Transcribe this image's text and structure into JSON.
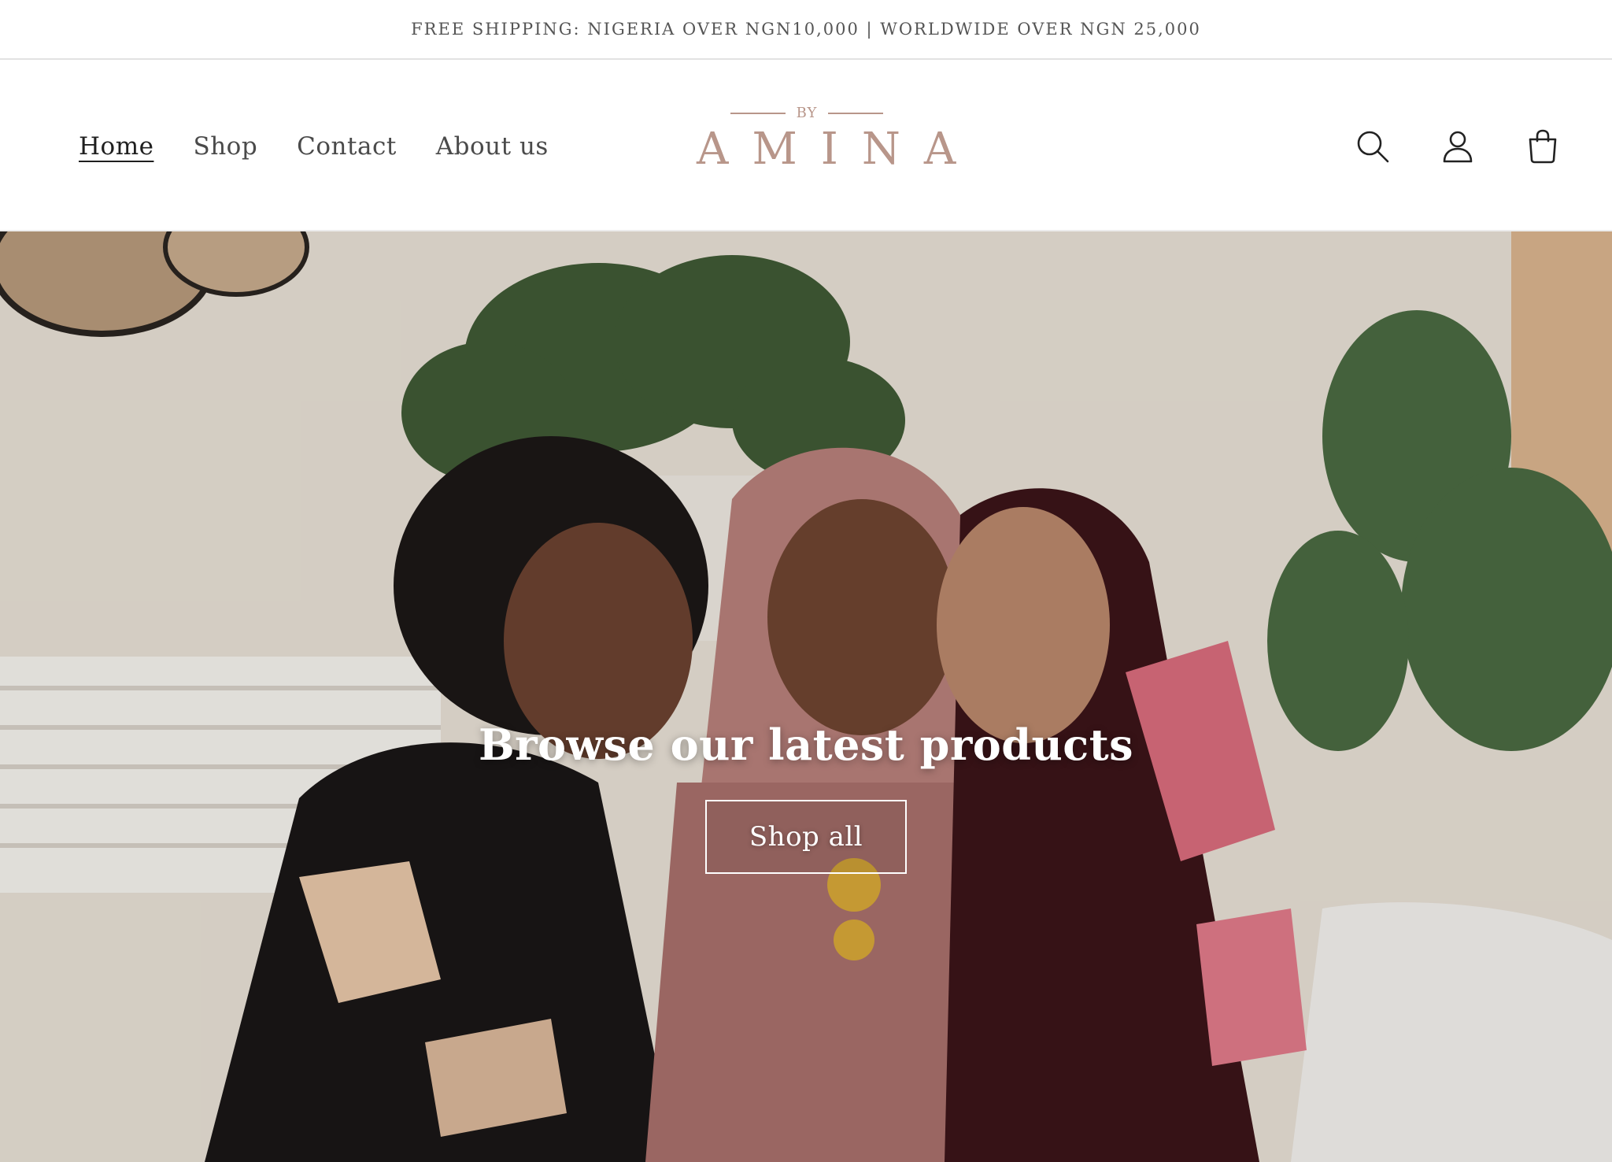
{
  "announcement": {
    "text": "FREE SHIPPING: NIGERIA OVER NGN10,000 | WORLDWIDE OVER NGN 25,000"
  },
  "header": {
    "nav": [
      {
        "label": "Home",
        "active": true
      },
      {
        "label": "Shop",
        "active": false
      },
      {
        "label": "Contact",
        "active": false
      },
      {
        "label": "About us",
        "active": false
      }
    ],
    "logo": {
      "by": "BY",
      "name": "AMINA",
      "color": "#b8968a"
    },
    "icons": [
      "search-icon",
      "account-icon",
      "cart-icon"
    ]
  },
  "hero": {
    "title": "Browse our latest products",
    "button_label": "Shop all"
  }
}
